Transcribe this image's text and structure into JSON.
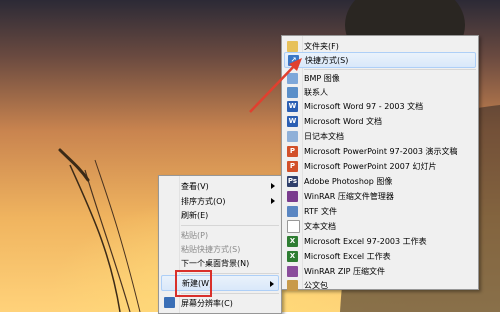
{
  "context_menu": {
    "items": [
      {
        "label": "查看(V)",
        "submenu": true
      },
      {
        "label": "排序方式(O)",
        "submenu": true
      },
      {
        "label": "刷新(E)"
      },
      {
        "label": "粘贴(P)",
        "disabled": true
      },
      {
        "label": "粘贴快捷方式(S)",
        "disabled": true
      },
      {
        "label": "下一个桌面背景(N)"
      },
      {
        "label": "新建(W)",
        "submenu": true
      },
      {
        "label": "屏幕分辨率(C)"
      }
    ]
  },
  "new_submenu": {
    "items": [
      {
        "label": "文件夹(F)",
        "icon": "folder-icon"
      },
      {
        "label": "快捷方式(S)",
        "icon": "shortcut-icon"
      },
      {
        "label": "BMP 图像",
        "icon": "bmp-icon"
      },
      {
        "label": "联系人",
        "icon": "contact-icon"
      },
      {
        "label": "Microsoft Word 97 - 2003 文档",
        "icon": "word-icon"
      },
      {
        "label": "Microsoft Word 文档",
        "icon": "word-icon"
      },
      {
        "label": "日记本文档",
        "icon": "journal-icon"
      },
      {
        "label": "Microsoft PowerPoint 97-2003 演示文稿",
        "icon": "powerpoint-icon"
      },
      {
        "label": "Microsoft PowerPoint 2007 幻灯片",
        "icon": "powerpoint-icon"
      },
      {
        "label": "Adobe Photoshop 图像",
        "icon": "photoshop-icon"
      },
      {
        "label": "WinRAR 压缩文件管理器",
        "icon": "winrar-icon"
      },
      {
        "label": "RTF 文件",
        "icon": "rtf-icon"
      },
      {
        "label": "文本文档",
        "icon": "text-icon"
      },
      {
        "label": "Microsoft Excel 97-2003 工作表",
        "icon": "excel-icon"
      },
      {
        "label": "Microsoft Excel 工作表",
        "icon": "excel-icon"
      },
      {
        "label": "WinRAR ZIP 压缩文件",
        "icon": "winrar-zip-icon"
      },
      {
        "label": "公文包",
        "icon": "briefcase-icon"
      }
    ]
  },
  "colors": {
    "highlight_box": "#d9302b",
    "arrow": "#e0402f",
    "menu_bg": "#f0f0f0"
  }
}
